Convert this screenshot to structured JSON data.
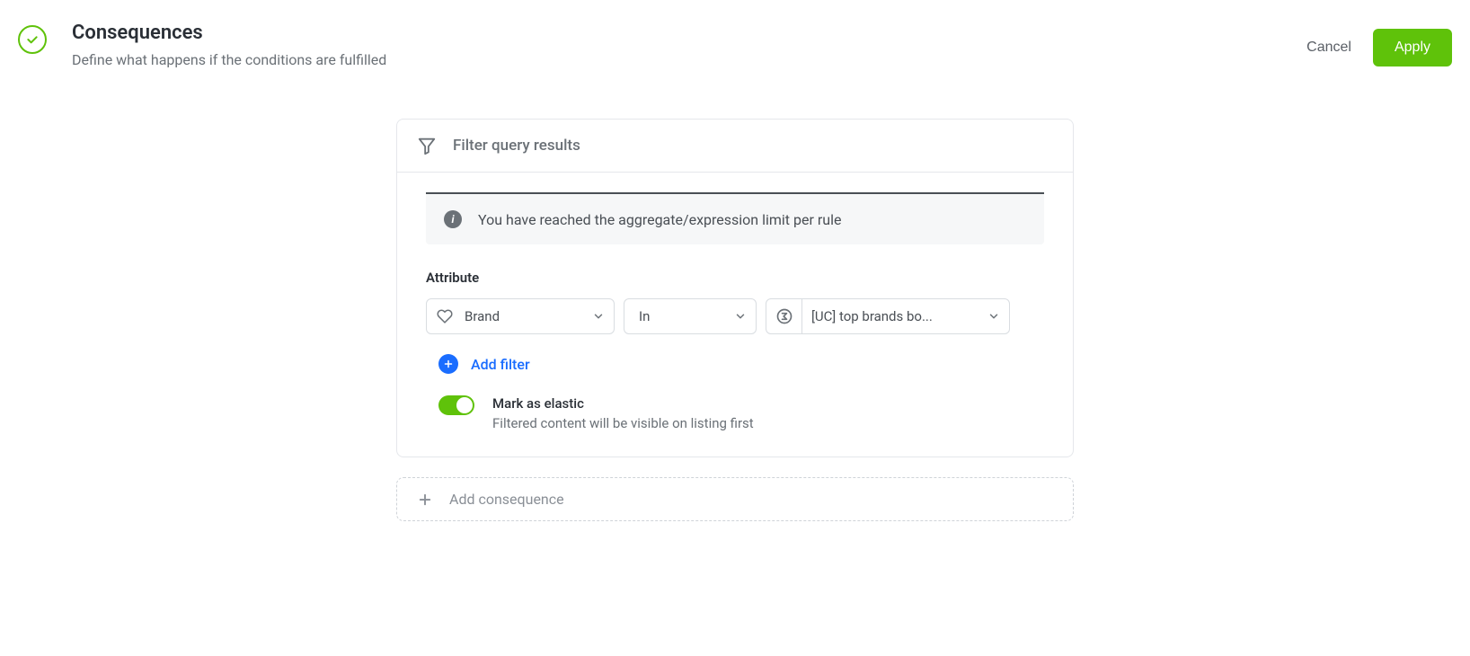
{
  "header": {
    "title": "Consequences",
    "subtitle": "Define what happens if the conditions are fulfilled",
    "cancel_label": "Cancel",
    "apply_label": "Apply"
  },
  "panel": {
    "header": "Filter query results",
    "info_message": "You have reached the aggregate/expression limit per rule",
    "section_label": "Attribute",
    "filter": {
      "attribute": "Brand",
      "operator": "In",
      "value": "[UC] top brands bo..."
    },
    "add_filter_label": "Add filter",
    "elastic": {
      "title": "Mark as elastic",
      "description": "Filtered content will be visible on listing first"
    }
  },
  "add_consequence_label": "Add consequence",
  "colors": {
    "accent_green": "#5fc20a",
    "accent_blue": "#1a6dff"
  }
}
